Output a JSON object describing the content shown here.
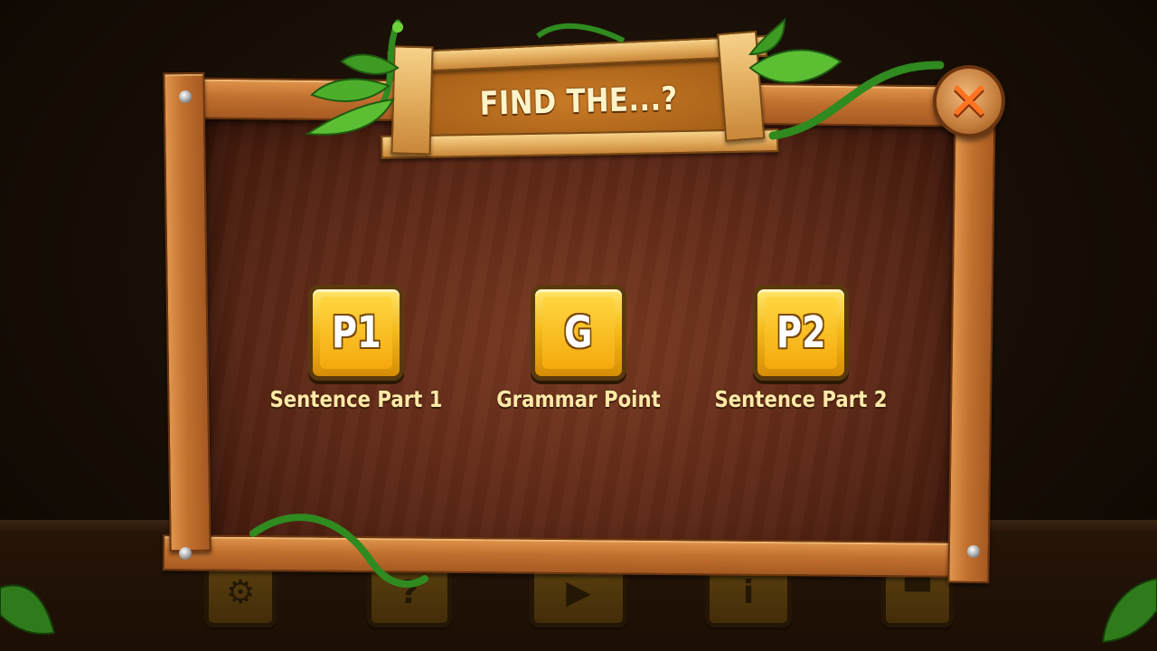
{
  "dialog": {
    "title": "FIND THE...?",
    "close_icon": "close-x-icon"
  },
  "options": [
    {
      "badge": "P1",
      "label": "Sentence Part 1"
    },
    {
      "badge": "G",
      "label": "Grammar Point"
    },
    {
      "badge": "P2",
      "label": "Sentence Part 2"
    }
  ],
  "bottom_toolbar": [
    {
      "icon": "gear-icon"
    },
    {
      "icon": "question-icon"
    },
    {
      "icon": "play-icon"
    },
    {
      "icon": "info-icon"
    },
    {
      "icon": "podium-icon"
    }
  ],
  "colors": {
    "board": "#5e2917",
    "wood": "#c2702f",
    "tile": "#f3b81a",
    "caption": "#ffe9a8",
    "close_x": "#ff7420",
    "vine": "#2f8a1f"
  }
}
